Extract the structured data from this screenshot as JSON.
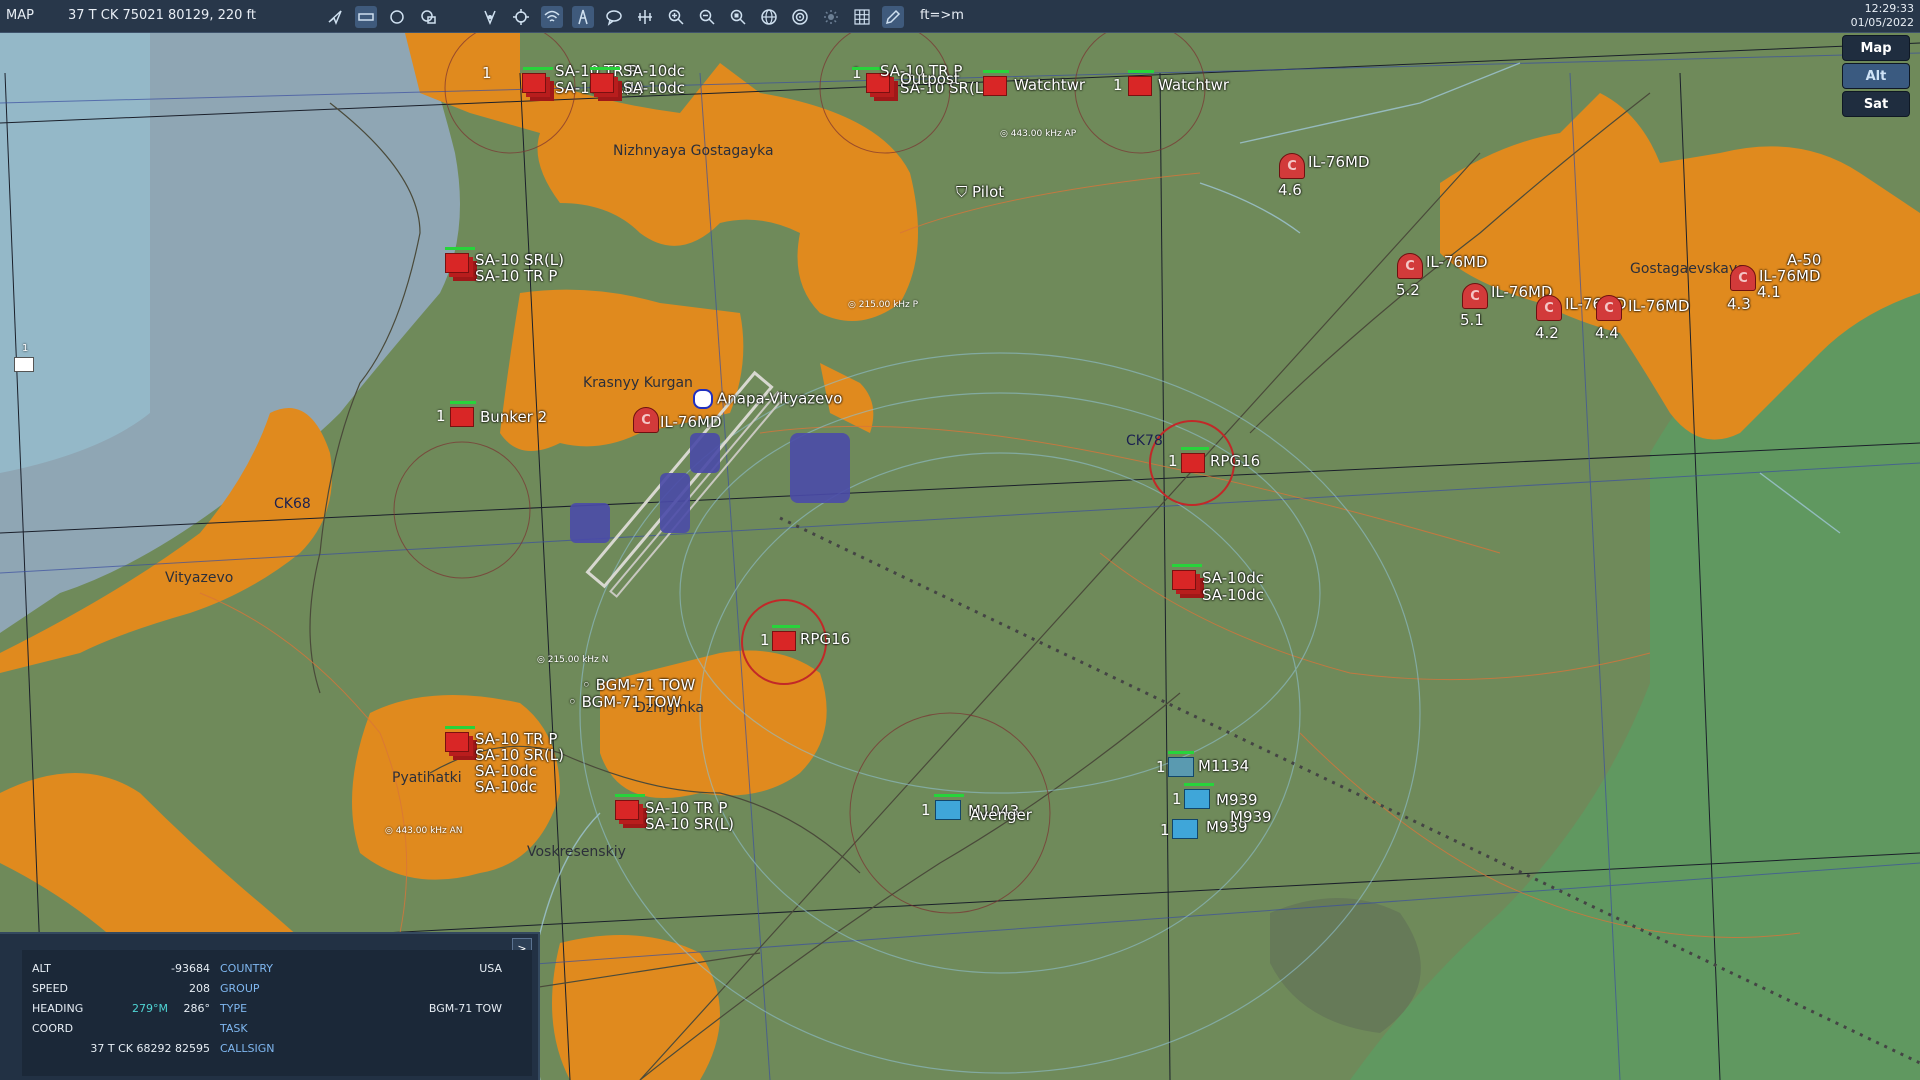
{
  "toolbar": {
    "title": "MAP",
    "coords": "37 T CK 75021 80129, 220 ft",
    "units_toggle": "ft=>m",
    "time": "12:29:33",
    "date": "01/05/2022",
    "icons": [
      "route-icon",
      "ruler-icon",
      "circle-icon",
      "layers-icon",
      "waypoint-icon",
      "target-icon",
      "wifi-icon",
      "tower-icon",
      "chat-icon",
      "split-icon",
      "zoom-in-icon",
      "zoom-out-icon",
      "zoom-fit-icon",
      "globe-icon",
      "radar-icon",
      "sun-icon",
      "grid-icon",
      "pencil-icon"
    ]
  },
  "map_types": [
    "Map",
    "Alt",
    "Sat"
  ],
  "active_map_type": "Alt",
  "towns": [
    "Nizhnyaya Gostagayka",
    "Krasnyy Kurgan",
    "Vityazevo",
    "Gostagaevskaya",
    "Pyatihatki",
    "Voskresenskiy",
    "Dzhiginka"
  ],
  "grid_labels": [
    "CK68",
    "CK78"
  ],
  "airfield": "Anapa-Vityazevo",
  "beacons": [
    "443.00 kHz AP",
    "215.00 kHz P",
    "215.00 kHz N",
    "443.00 kHz AN"
  ],
  "units": {
    "sam_label_1": "SA-10 TR P",
    "sam_label_2": "SA-10 SR(L)",
    "sam_label_3": "SA-10dc",
    "bunker": "Bunker 2",
    "outpost": "Outpost",
    "watchtower_1": "Watchtwr",
    "watchtower_2": "Watchtwr",
    "pilot": "Pilot",
    "rpg_1": "RPG16",
    "rpg_2": "RPG16",
    "tow_1": "BGM-71 TOW",
    "tow_2": "BGM-71 TOW",
    "m1134": "M1134",
    "m939": "M939",
    "m1043": "M1043",
    "avenger": "Avenger",
    "il76_label": "IL-76MD",
    "a50": "A-50",
    "count_one": "1"
  },
  "aircraft_groups": [
    {
      "name": "IL-76MD",
      "id": "4.6"
    },
    {
      "name": "IL-76MD",
      "id": "5.2"
    },
    {
      "name": "IL-76MD",
      "id": "5.1"
    },
    {
      "name": "IL-76MD",
      "id": "4.2"
    },
    {
      "name": "IL-76MD",
      "id": "4.4"
    },
    {
      "name": "IL-76MD",
      "id": "4.3"
    },
    {
      "name": "A-50",
      "id": "4.1"
    }
  ],
  "info_panel": {
    "alt_label": "ALT",
    "alt_value": "-93684",
    "speed_label": "SPEED",
    "speed_value": "208",
    "heading_label": "HEADING",
    "heading_mag": "279°M",
    "heading_true": "286°",
    "coord_label": "COORD",
    "coord_value": "37 T CK 68292 82595",
    "country_label": "COUNTRY",
    "country_value": "USA",
    "group_label": "GROUP",
    "type_label": "TYPE",
    "type_value": "BGM-71 TOW",
    "task_label": "TASK",
    "callsign_label": "CALLSIGN",
    "expand": ">"
  },
  "colors": {
    "terrain": "#6f8a5a",
    "urban": "#e08a1e",
    "sea": "#8fa6b4",
    "toolbar": "#28374a",
    "red_unit": "#d92626",
    "blue_unit": "#3fa6d9",
    "health_bar": "#27d43b"
  },
  "mail_count": "1"
}
